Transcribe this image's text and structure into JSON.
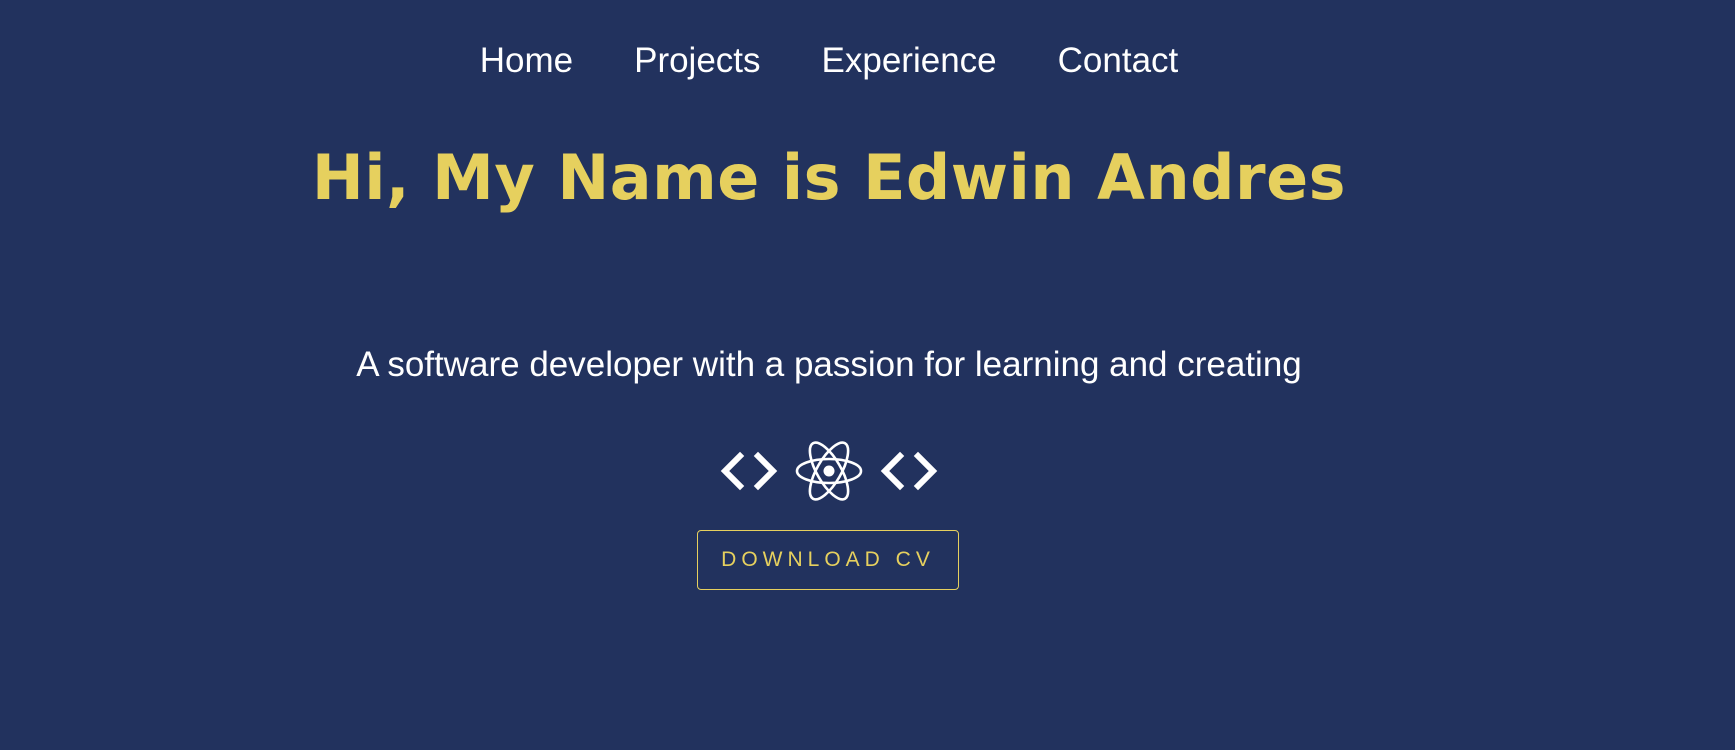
{
  "nav": {
    "items": [
      {
        "label": "Home"
      },
      {
        "label": "Projects"
      },
      {
        "label": "Experience"
      },
      {
        "label": "Contact"
      }
    ]
  },
  "hero": {
    "title": "Hi, My Name is Edwin Andres",
    "subtitle": "A software developer with a passion for learning and creating",
    "icons": [
      "code-brackets-icon",
      "react-atom-icon",
      "code-brackets-icon"
    ],
    "download_label": "DOWNLOAD CV"
  },
  "colors": {
    "background": "#22325e",
    "accent": "#e6d05e",
    "text": "#ffffff"
  }
}
